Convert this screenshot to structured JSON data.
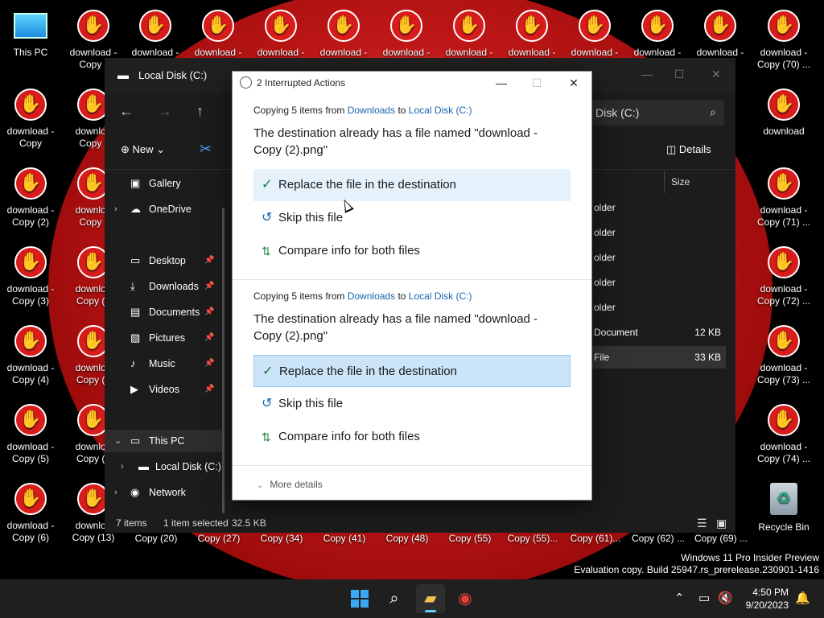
{
  "desktop": {
    "this_pc": "This PC",
    "recycle_bin": "Recycle Bin",
    "row1": [
      "download -\nCopy (",
      "download -",
      "download -",
      "download -",
      "download -",
      "download -",
      "download -",
      "download -",
      "download -",
      "download -",
      "download -",
      "download -\nCopy (70) ..."
    ],
    "left_col": [
      "download -\nCopy",
      "download -\nCopy (2)",
      "download -\nCopy (3)",
      "download -\nCopy (4)",
      "download -\nCopy (5)",
      "download -\nCopy (6)"
    ],
    "right_col": [
      "download",
      "download -\nCopy (71) ...",
      "download -\nCopy (72) ...",
      "download -\nCopy (73) ...",
      "download -\nCopy (74) ..."
    ],
    "col2": [
      "downloa\nCopy (",
      "downloa\nCopy (",
      "downloa\nCopy (1",
      "downloa\nCopy (1",
      "downloa\nCopy (1",
      "downloa\nCopy (13)"
    ],
    "bottom_row": [
      "Copy (20)",
      "Copy (27)",
      "Copy (34)",
      "Copy (41)",
      "Copy (48)",
      "Copy (55)",
      "Copy (55)...",
      "Copy (61)...",
      "Copy (62) ...",
      "Copy (69) ..."
    ]
  },
  "explorer": {
    "title": "Local Disk (C:)",
    "address": "Disk (C:)",
    "cmd_new": "New",
    "cmd_details": "Details",
    "col_size": "Size",
    "sidebar": [
      {
        "label": "Gallery",
        "icon": "▣",
        "pinned": false,
        "chevron": ""
      },
      {
        "label": "OneDrive",
        "icon": "☁",
        "pinned": false,
        "chevron": "›"
      },
      {
        "label": "Desktop",
        "icon": "▭",
        "pinned": true,
        "chevron": ""
      },
      {
        "label": "Downloads",
        "icon": "⤓",
        "pinned": true,
        "chevron": ""
      },
      {
        "label": "Documents",
        "icon": "▤",
        "pinned": true,
        "chevron": ""
      },
      {
        "label": "Pictures",
        "icon": "▨",
        "pinned": true,
        "chevron": ""
      },
      {
        "label": "Music",
        "icon": "♪",
        "pinned": true,
        "chevron": ""
      },
      {
        "label": "Videos",
        "icon": "▶",
        "pinned": true,
        "chevron": ""
      },
      {
        "label": "This PC",
        "icon": "▭",
        "pinned": false,
        "chevron": "⌄"
      },
      {
        "label": "Local Disk (C:)",
        "icon": "▬",
        "pinned": false,
        "chevron": "›"
      },
      {
        "label": "Network",
        "icon": "◉",
        "pinned": false,
        "chevron": "›"
      }
    ],
    "files": [
      {
        "name": "older",
        "size": ""
      },
      {
        "name": "older",
        "size": ""
      },
      {
        "name": "older",
        "size": ""
      },
      {
        "name": "older",
        "size": ""
      },
      {
        "name": "older",
        "size": ""
      },
      {
        "name": "Document",
        "size": "12 KB"
      },
      {
        "name": "File",
        "size": "33 KB"
      }
    ],
    "status": {
      "items": "7 items",
      "selected": "1 item selected",
      "size": "32.5 KB"
    }
  },
  "dialog": {
    "title": "2 Interrupted Actions",
    "sections": [
      {
        "copying_prefix": "Copying 5 items from",
        "from": "Downloads",
        "to_word": "to",
        "to": "Local Disk (C:)",
        "message": "The destination already has a file named \"download - Copy (2).png\"",
        "replace": "Replace the file in the destination",
        "skip": "Skip this file",
        "compare": "Compare info for both files"
      },
      {
        "copying_prefix": "Copying 5 items from",
        "from": "Downloads",
        "to_word": "to",
        "to": "Local Disk (C:)",
        "message": "The destination already has a file named \"download - Copy (2).png\"",
        "replace": "Replace the file in the destination",
        "skip": "Skip this file",
        "compare": "Compare info for both files"
      }
    ],
    "more_details": "More details"
  },
  "watermark": {
    "line1": "Windows 11 Pro Insider Preview",
    "line2": "Evaluation copy. Build 25947.rs_prerelease.230901-1416"
  },
  "taskbar": {
    "time": "4:50 PM",
    "date": "9/20/2023"
  },
  "colors": {
    "accent": "#60cdff",
    "link": "#1a63b0",
    "selected_option": "#cce4f7"
  }
}
